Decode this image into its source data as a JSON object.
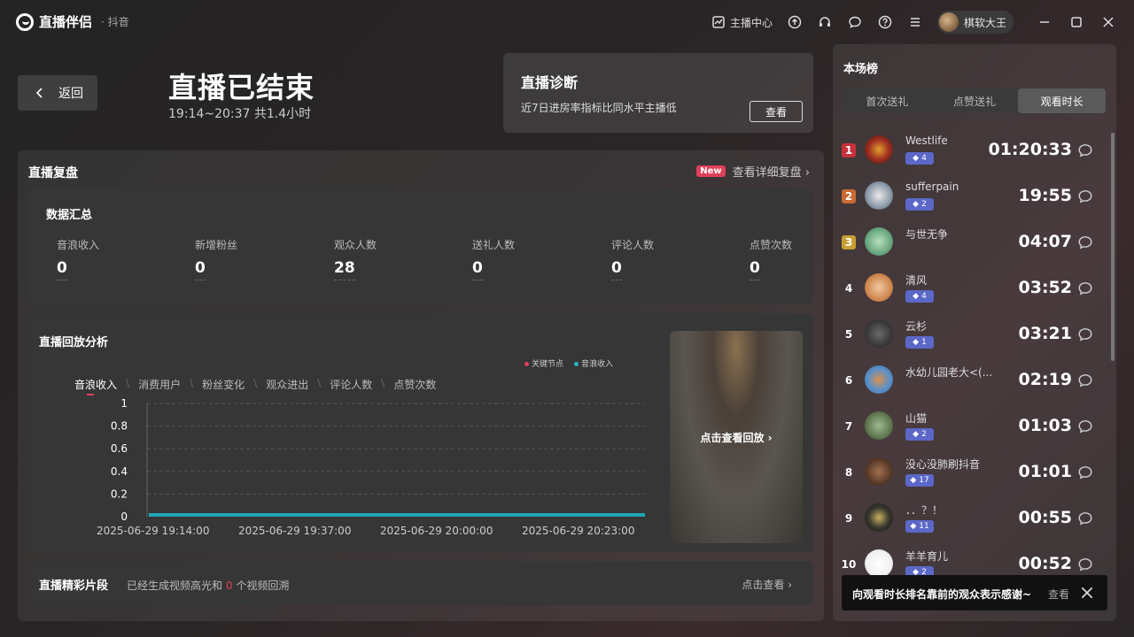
{
  "app": {
    "name": "直播伴侣",
    "sub": "· 抖音"
  },
  "titlebar": {
    "creator_center": "主播中心",
    "username": "棋软大王"
  },
  "header": {
    "back_label": "返回",
    "title": "直播已结束",
    "time_range": "19:14~20:37 共1.4小时"
  },
  "diagnosis": {
    "title": "直播诊断",
    "desc": "近7日进房率指标比同水平主播低",
    "button": "查看"
  },
  "review": {
    "title": "直播复盘",
    "new_badge": "New",
    "detail_link": "查看详细复盘 ›",
    "summary": {
      "title": "数据汇总",
      "metrics": [
        {
          "label": "音浪收入",
          "value": "0"
        },
        {
          "label": "新增粉丝",
          "value": "0"
        },
        {
          "label": "观众人数",
          "value": "28"
        },
        {
          "label": "送礼人数",
          "value": "0"
        },
        {
          "label": "评论人数",
          "value": "0"
        },
        {
          "label": "点赞次数",
          "value": "0"
        }
      ]
    },
    "analysis": {
      "title": "直播回放分析",
      "legend": {
        "key_node": "关键节点",
        "income": "音浪收入"
      },
      "tabs": [
        "音浪收入",
        "消费用户",
        "粉丝变化",
        "观众进出",
        "评论人数",
        "点赞次数"
      ],
      "playback": "点击查看回放 ›"
    },
    "highlights": {
      "title": "直播精彩片段",
      "desc_prefix": "已经生成视频高光和",
      "count": "0",
      "desc_suffix": "个视频回溯",
      "link": "点击查看 ›"
    }
  },
  "chart_data": {
    "type": "area",
    "x": [
      "2025-06-29 19:14:00",
      "2025-06-29 19:37:00",
      "2025-06-29 20:00:00",
      "2025-06-29 20:23:00"
    ],
    "yticks": [
      "1",
      "0.8",
      "0.6",
      "0.4",
      "0.2",
      "0"
    ],
    "ylim": [
      0,
      1
    ],
    "series": [
      {
        "name": "音浪收入",
        "values": [
          0,
          0,
          0,
          0
        ]
      }
    ],
    "color": "#1eb4c8",
    "grid": true
  },
  "ranking": {
    "title": "本场榜",
    "tabs": [
      "首次送礼",
      "点赞送礼",
      "观看时长"
    ],
    "active_tab": 2,
    "items": [
      {
        "rank": "1",
        "name": "Westlife",
        "badge": "4",
        "time": "01:20:33",
        "avatar": "radial-gradient(circle, #e0a030 0%, #a03020 50%, #401010 100%)"
      },
      {
        "rank": "2",
        "name": "sufferpain",
        "badge": "2",
        "time": "19:55",
        "avatar": "radial-gradient(circle, #eaeaea 0%, #8a9aa8 60%, #3a4048 100%)"
      },
      {
        "rank": "3",
        "name": "与世无争",
        "badge": "",
        "time": "04:07",
        "avatar": "radial-gradient(circle, #b8e0c0 0%, #6aa880 60%, #3a6848 100%)"
      },
      {
        "rank": "4",
        "name": "清风",
        "badge": "4",
        "time": "03:52",
        "avatar": "radial-gradient(circle, #f0c8a0 0%, #d08850 60%, #a05a30 100%)"
      },
      {
        "rank": "5",
        "name": "云杉",
        "badge": "1",
        "time": "03:21",
        "avatar": "radial-gradient(circle, #6a6a6a 0%, #3a3a3a 60%, #202020 100%)"
      },
      {
        "rank": "6",
        "name": "水幼儿园老大<(...",
        "badge": "",
        "time": "02:19",
        "avatar": "radial-gradient(circle, #d89050 0%, #5a90c8 55%, #3a6aa0 100%)"
      },
      {
        "rank": "7",
        "name": "山猫",
        "badge": "2",
        "time": "01:03",
        "avatar": "radial-gradient(circle, #a0b890 0%, #607850 60%, #384830 100%)"
      },
      {
        "rank": "8",
        "name": "没心没肺刷抖音",
        "badge": "17",
        "time": "01:01",
        "avatar": "radial-gradient(circle, #a07050 0%, #5a3a28 60%, #2a1a10 100%)"
      },
      {
        "rank": "9",
        "name": "．．？！",
        "badge": "11",
        "time": "00:55",
        "avatar": "radial-gradient(circle, #c8b060 0%, #3a3a30 50%, #101010 100%)"
      },
      {
        "rank": "10",
        "name": "羊羊育儿",
        "badge": "2",
        "time": "00:52",
        "avatar": "radial-gradient(circle, #ffffff 0%, #f0f0f0 60%, #d0d0d0 100%)"
      }
    ]
  },
  "toast": {
    "text": "向观看时长排名靠前的观众表示感谢~",
    "view": "查看"
  }
}
